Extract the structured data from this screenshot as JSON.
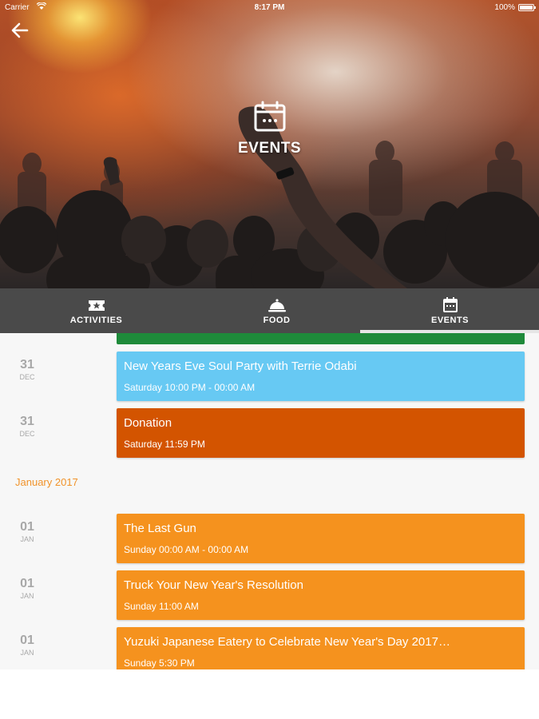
{
  "status_bar": {
    "carrier": "Carrier",
    "time": "8:17 PM",
    "battery": "100%"
  },
  "hero": {
    "title": "EVENTS",
    "icon": "calendar-icon"
  },
  "tabs": [
    {
      "label": "ACTIVITIES",
      "icon": "ticket-star-icon",
      "active": false
    },
    {
      "label": "FOOD",
      "icon": "cloche-icon",
      "active": false
    },
    {
      "label": "EVENTS",
      "icon": "calendar-icon",
      "active": true
    }
  ],
  "colors": {
    "tabbar": "#4a4a4a",
    "month_heading": "#f1932a",
    "green": "#1e8a3a",
    "blue": "#67c9f3",
    "dark_orange": "#d35400",
    "orange": "#f5921e"
  },
  "events": [
    {
      "day": "31",
      "month": "DEC",
      "title": "New Years Eve Soul Party with Terrie Odabi",
      "when": "Saturday 10:00 PM - 00:00 AM",
      "color": "#67c9f3"
    },
    {
      "day": "31",
      "month": "DEC",
      "title": "Donation",
      "when": "Saturday 11:59 PM",
      "color": "#d35400"
    }
  ],
  "month_heading": "January 2017",
  "january_events": [
    {
      "day": "01",
      "month": "JAN",
      "title": "The Last Gun",
      "when": "Sunday 00:00 AM - 00:00 AM",
      "color": "#f5921e"
    },
    {
      "day": "01",
      "month": "JAN",
      "title": "Truck Your New Year's Resolution",
      "when": "Sunday 11:00 AM",
      "color": "#f5921e"
    },
    {
      "day": "01",
      "month": "JAN",
      "title": "Yuzuki Japanese Eatery to Celebrate New Year's Day 2017…",
      "when": "Sunday 5:30 PM",
      "color": "#f5921e"
    }
  ]
}
